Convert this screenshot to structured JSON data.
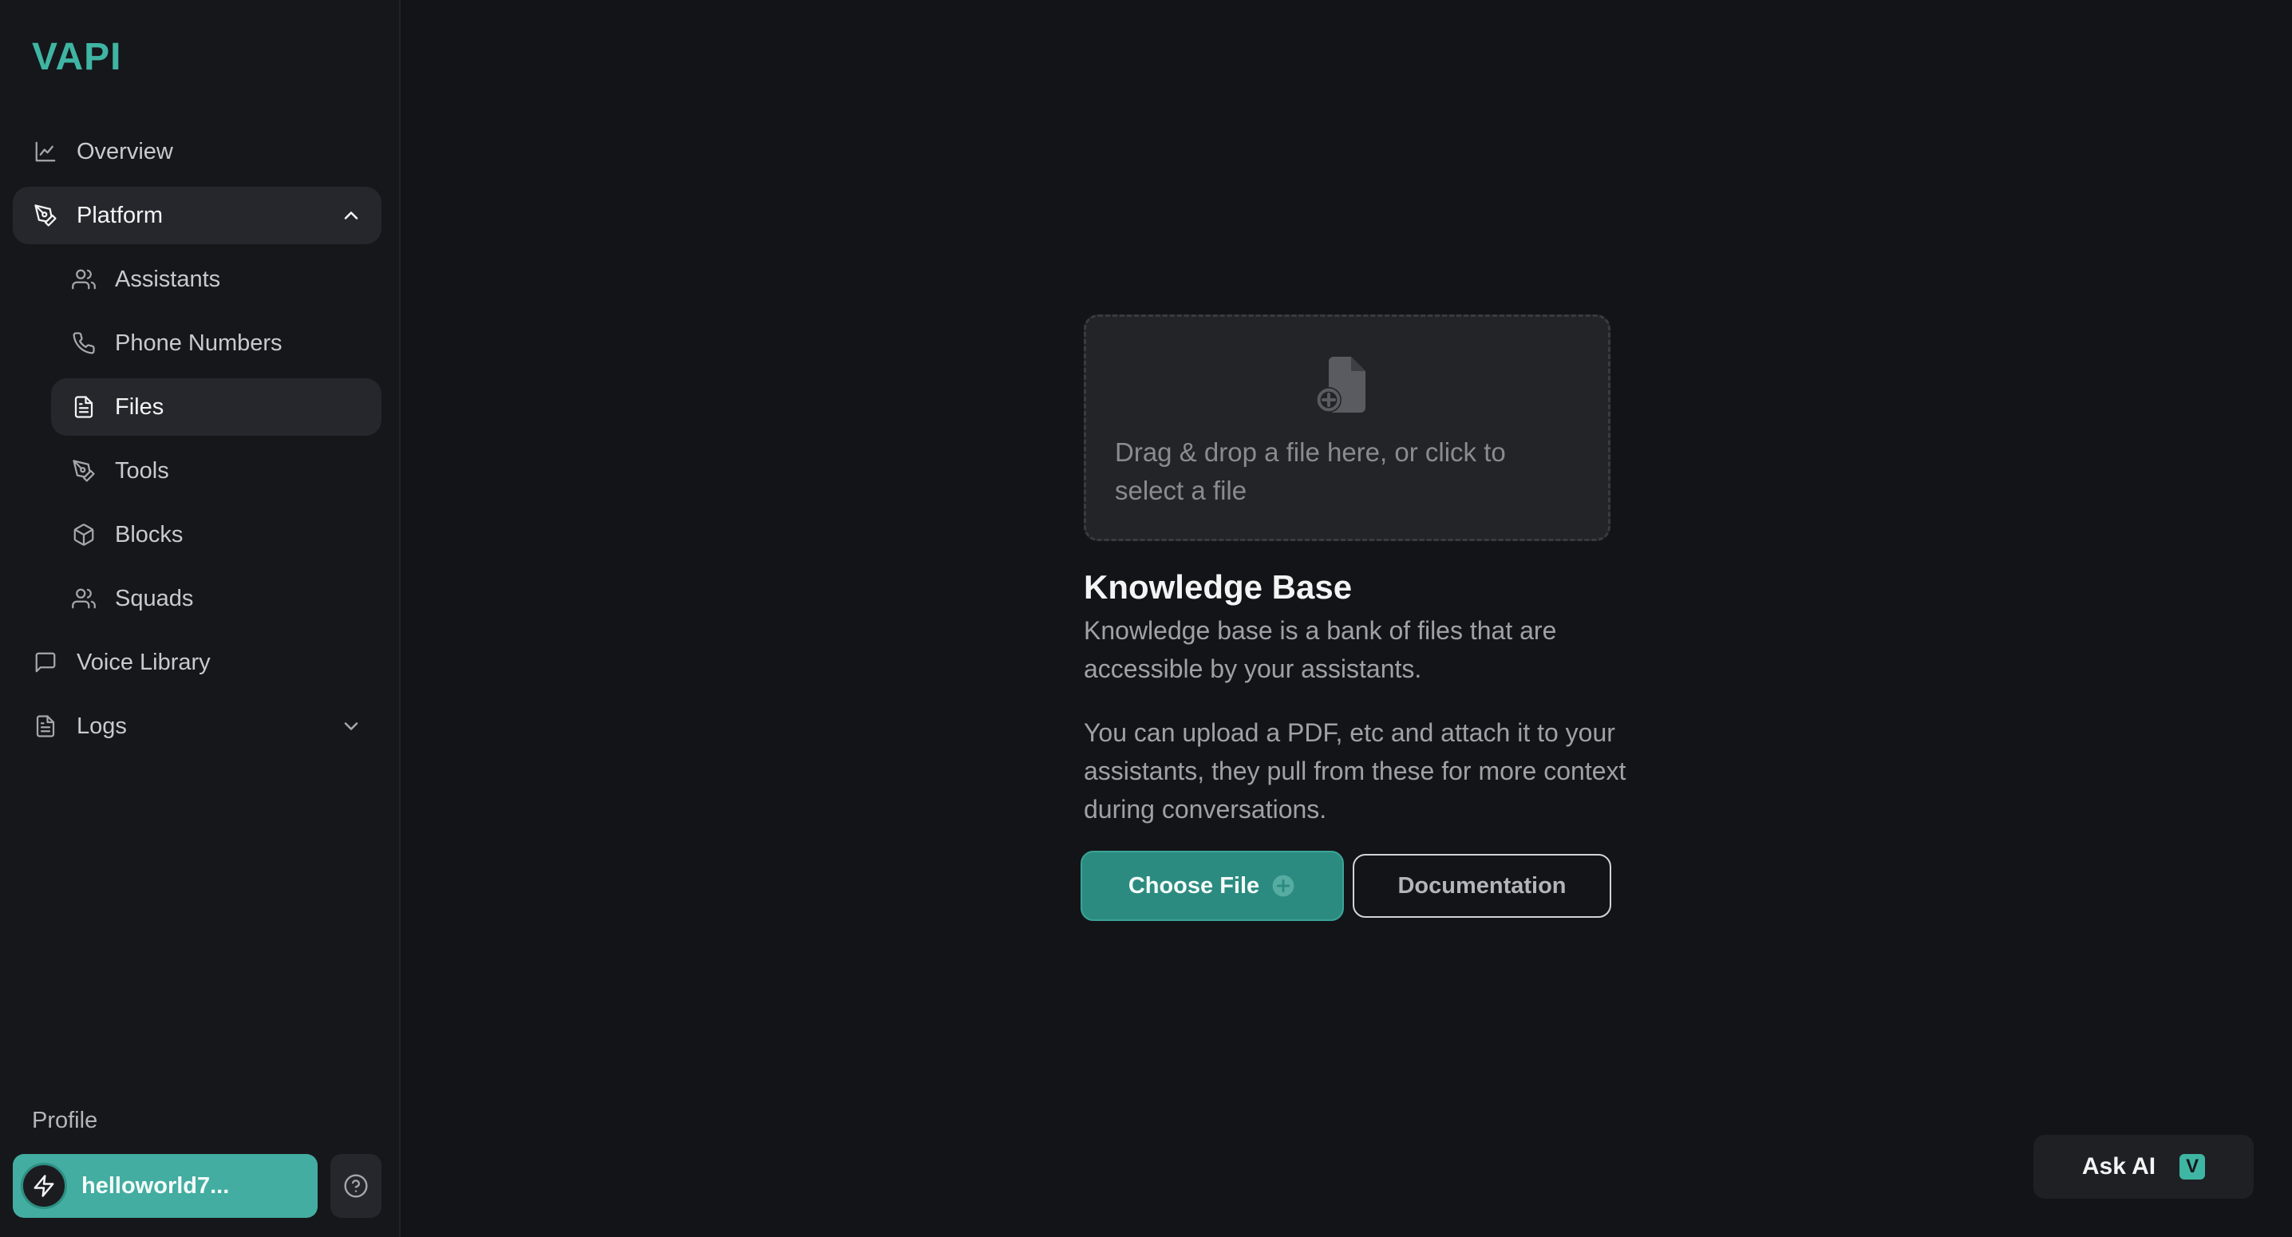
{
  "app": {
    "logo": "VAPI"
  },
  "sidebar": {
    "overview": {
      "label": "Overview",
      "icon": "chart-line-icon"
    },
    "platform": {
      "label": "Platform",
      "icon": "pen-tool-icon",
      "expanded": true
    },
    "platform_items": [
      {
        "label": "Assistants",
        "icon": "users-icon"
      },
      {
        "label": "Phone Numbers",
        "icon": "phone-icon"
      },
      {
        "label": "Files",
        "icon": "file-text-icon",
        "active": true
      },
      {
        "label": "Tools",
        "icon": "pen-tool-icon"
      },
      {
        "label": "Blocks",
        "icon": "box-icon"
      },
      {
        "label": "Squads",
        "icon": "users-icon"
      }
    ],
    "voice_library": {
      "label": "Voice Library",
      "icon": "message-square-icon"
    },
    "logs": {
      "label": "Logs",
      "icon": "file-text-icon",
      "expanded": false
    },
    "profile_label": "Profile",
    "user": {
      "name": "helloworld7...",
      "icon": "lightning-icon"
    },
    "help_icon": "help-circle-icon"
  },
  "main": {
    "dropzone": {
      "text": "Drag & drop a file here, or click to select a file",
      "icon": "file-plus-icon"
    },
    "title": "Knowledge Base",
    "description": "Knowledge base is a bank of files that are accessible by your assistants.",
    "description2": "You can upload a PDF, etc and attach it to your assistants, they pull from these for more context during conversations.",
    "choose_file_label": "Choose File",
    "documentation_label": "Documentation"
  },
  "ask_ai": {
    "label": "Ask AI",
    "badge": "V"
  },
  "colors": {
    "accent": "#3fb5a3",
    "background": "#131418",
    "sidebar": "#16171b"
  }
}
